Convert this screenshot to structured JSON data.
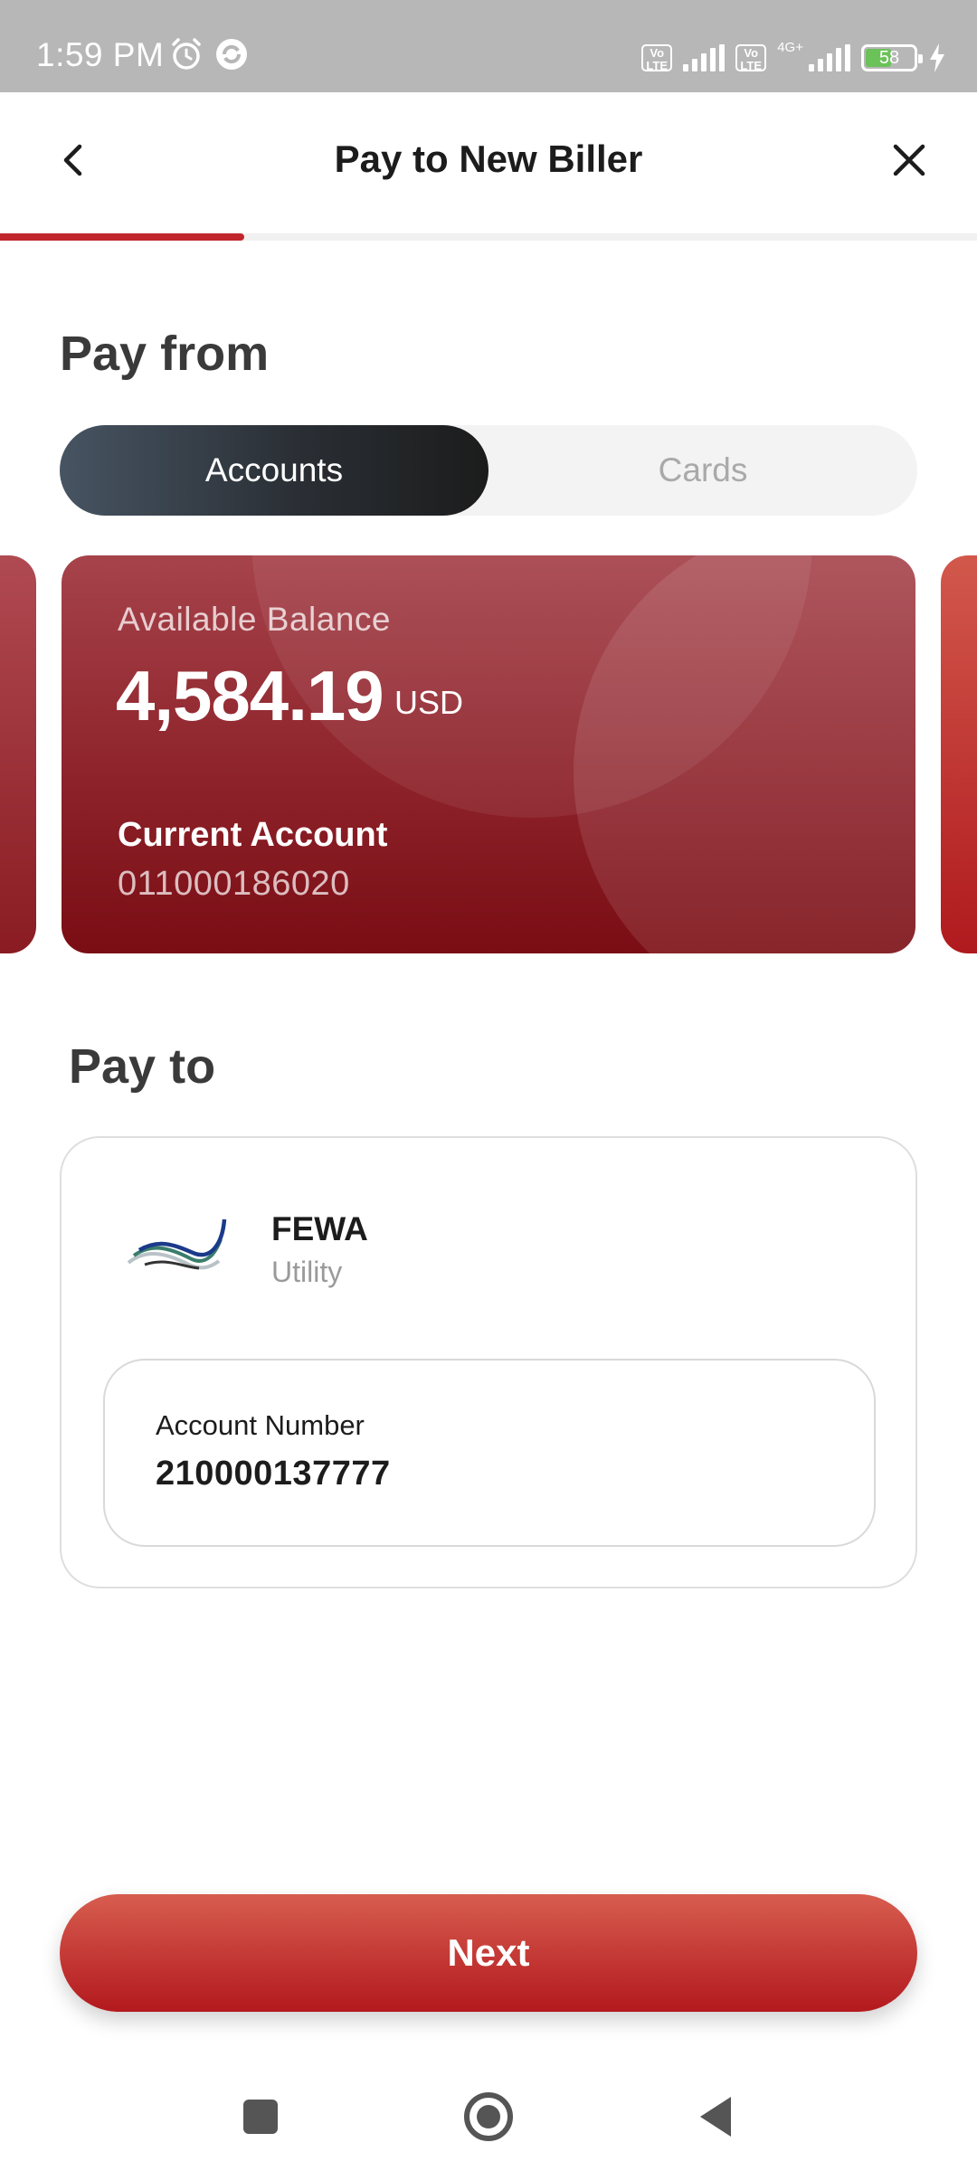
{
  "status_bar": {
    "time": "1:59 PM",
    "network_label": "4G+",
    "volte_label": "Vo LTE",
    "battery_level": "58"
  },
  "header": {
    "title": "Pay to New Biller",
    "progress_fraction": 0.25
  },
  "pay_from": {
    "title": "Pay from",
    "tabs": [
      {
        "label": "Accounts",
        "active": true
      },
      {
        "label": "Cards",
        "active": false
      }
    ],
    "card": {
      "balance_label": "Available Balance",
      "balance": "4,584.19",
      "currency": "USD",
      "account_type": "Current Account",
      "account_number": "011000186020"
    }
  },
  "pay_to": {
    "title": "Pay to",
    "biller_name": "FEWA",
    "biller_category": "Utility",
    "account_field": {
      "label": "Account Number",
      "value": "210000137777"
    }
  },
  "actions": {
    "next_label": "Next"
  },
  "colors": {
    "accent": "#c0262b",
    "card_dark": "#7a0d14",
    "segment_active": "#2a2f35"
  },
  "icons": {
    "back": "chevron-left-icon",
    "close": "close-icon",
    "alarm": "alarm-icon",
    "sync": "sync-icon",
    "nav_recents": "square-icon",
    "nav_home": "circle-icon",
    "nav_back": "triangle-back-icon"
  }
}
